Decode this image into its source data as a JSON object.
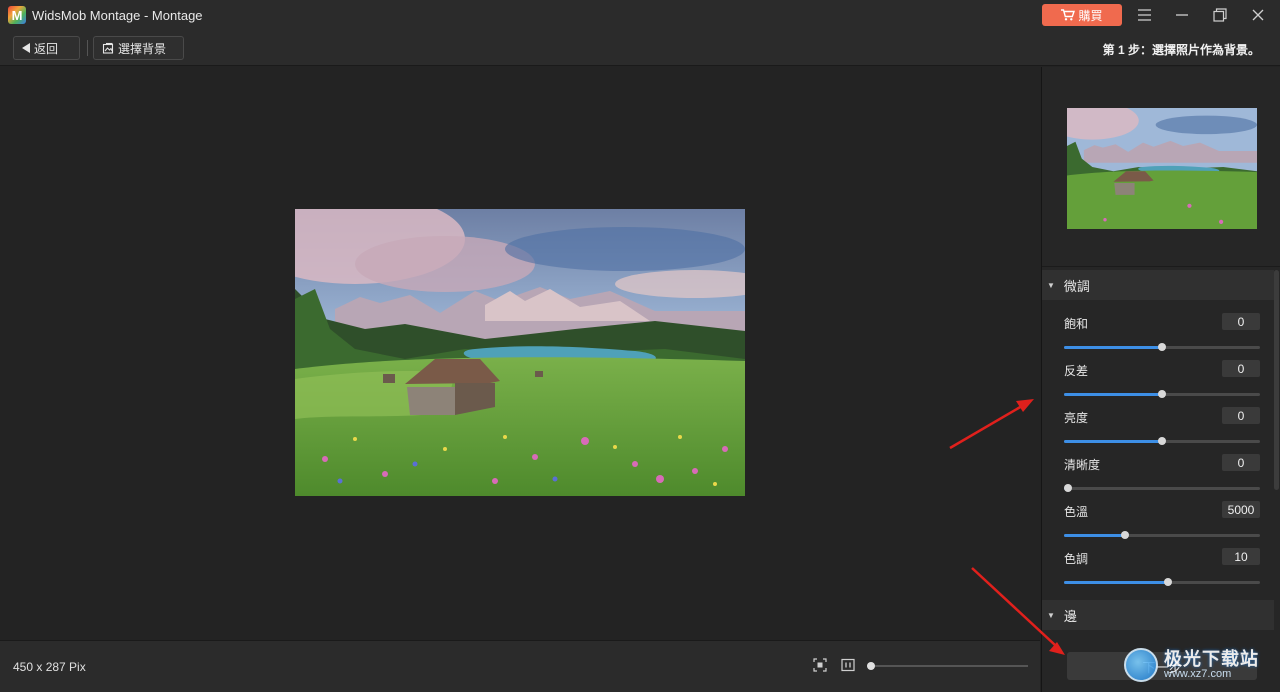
{
  "window": {
    "title": "WidsMob Montage - Montage",
    "logo_letter": "M",
    "buy_label": "購買"
  },
  "toolbar": {
    "back_label": "返回",
    "choose_bg_label": "選擇背景",
    "step_text": "第 1 步：選擇照片作為背景。"
  },
  "panel": {
    "sections": {
      "fine_tune": "微調",
      "edge": "邊"
    },
    "adjustments": [
      {
        "label": "飽和",
        "value": "0",
        "level": 0.5
      },
      {
        "label": "反差",
        "value": "0",
        "level": 0.5
      },
      {
        "label": "亮度",
        "value": "0",
        "level": 0.5
      },
      {
        "label": "清晰度",
        "value": "0",
        "level": 0.02
      },
      {
        "label": "色溫",
        "value": "5000",
        "level": 0.31
      },
      {
        "label": "色調",
        "value": "10",
        "level": 0.53
      }
    ],
    "next_label": "下一步"
  },
  "status": {
    "image_size": "450 x 287 Pix",
    "zoom_level": 0.0
  },
  "colors": {
    "accent": "#3d8fe6",
    "buy": "#f06a4e",
    "annotation_arrow": "#e0201c"
  },
  "watermark": {
    "cn": "极光下载站",
    "url": "www.xz7.com"
  }
}
